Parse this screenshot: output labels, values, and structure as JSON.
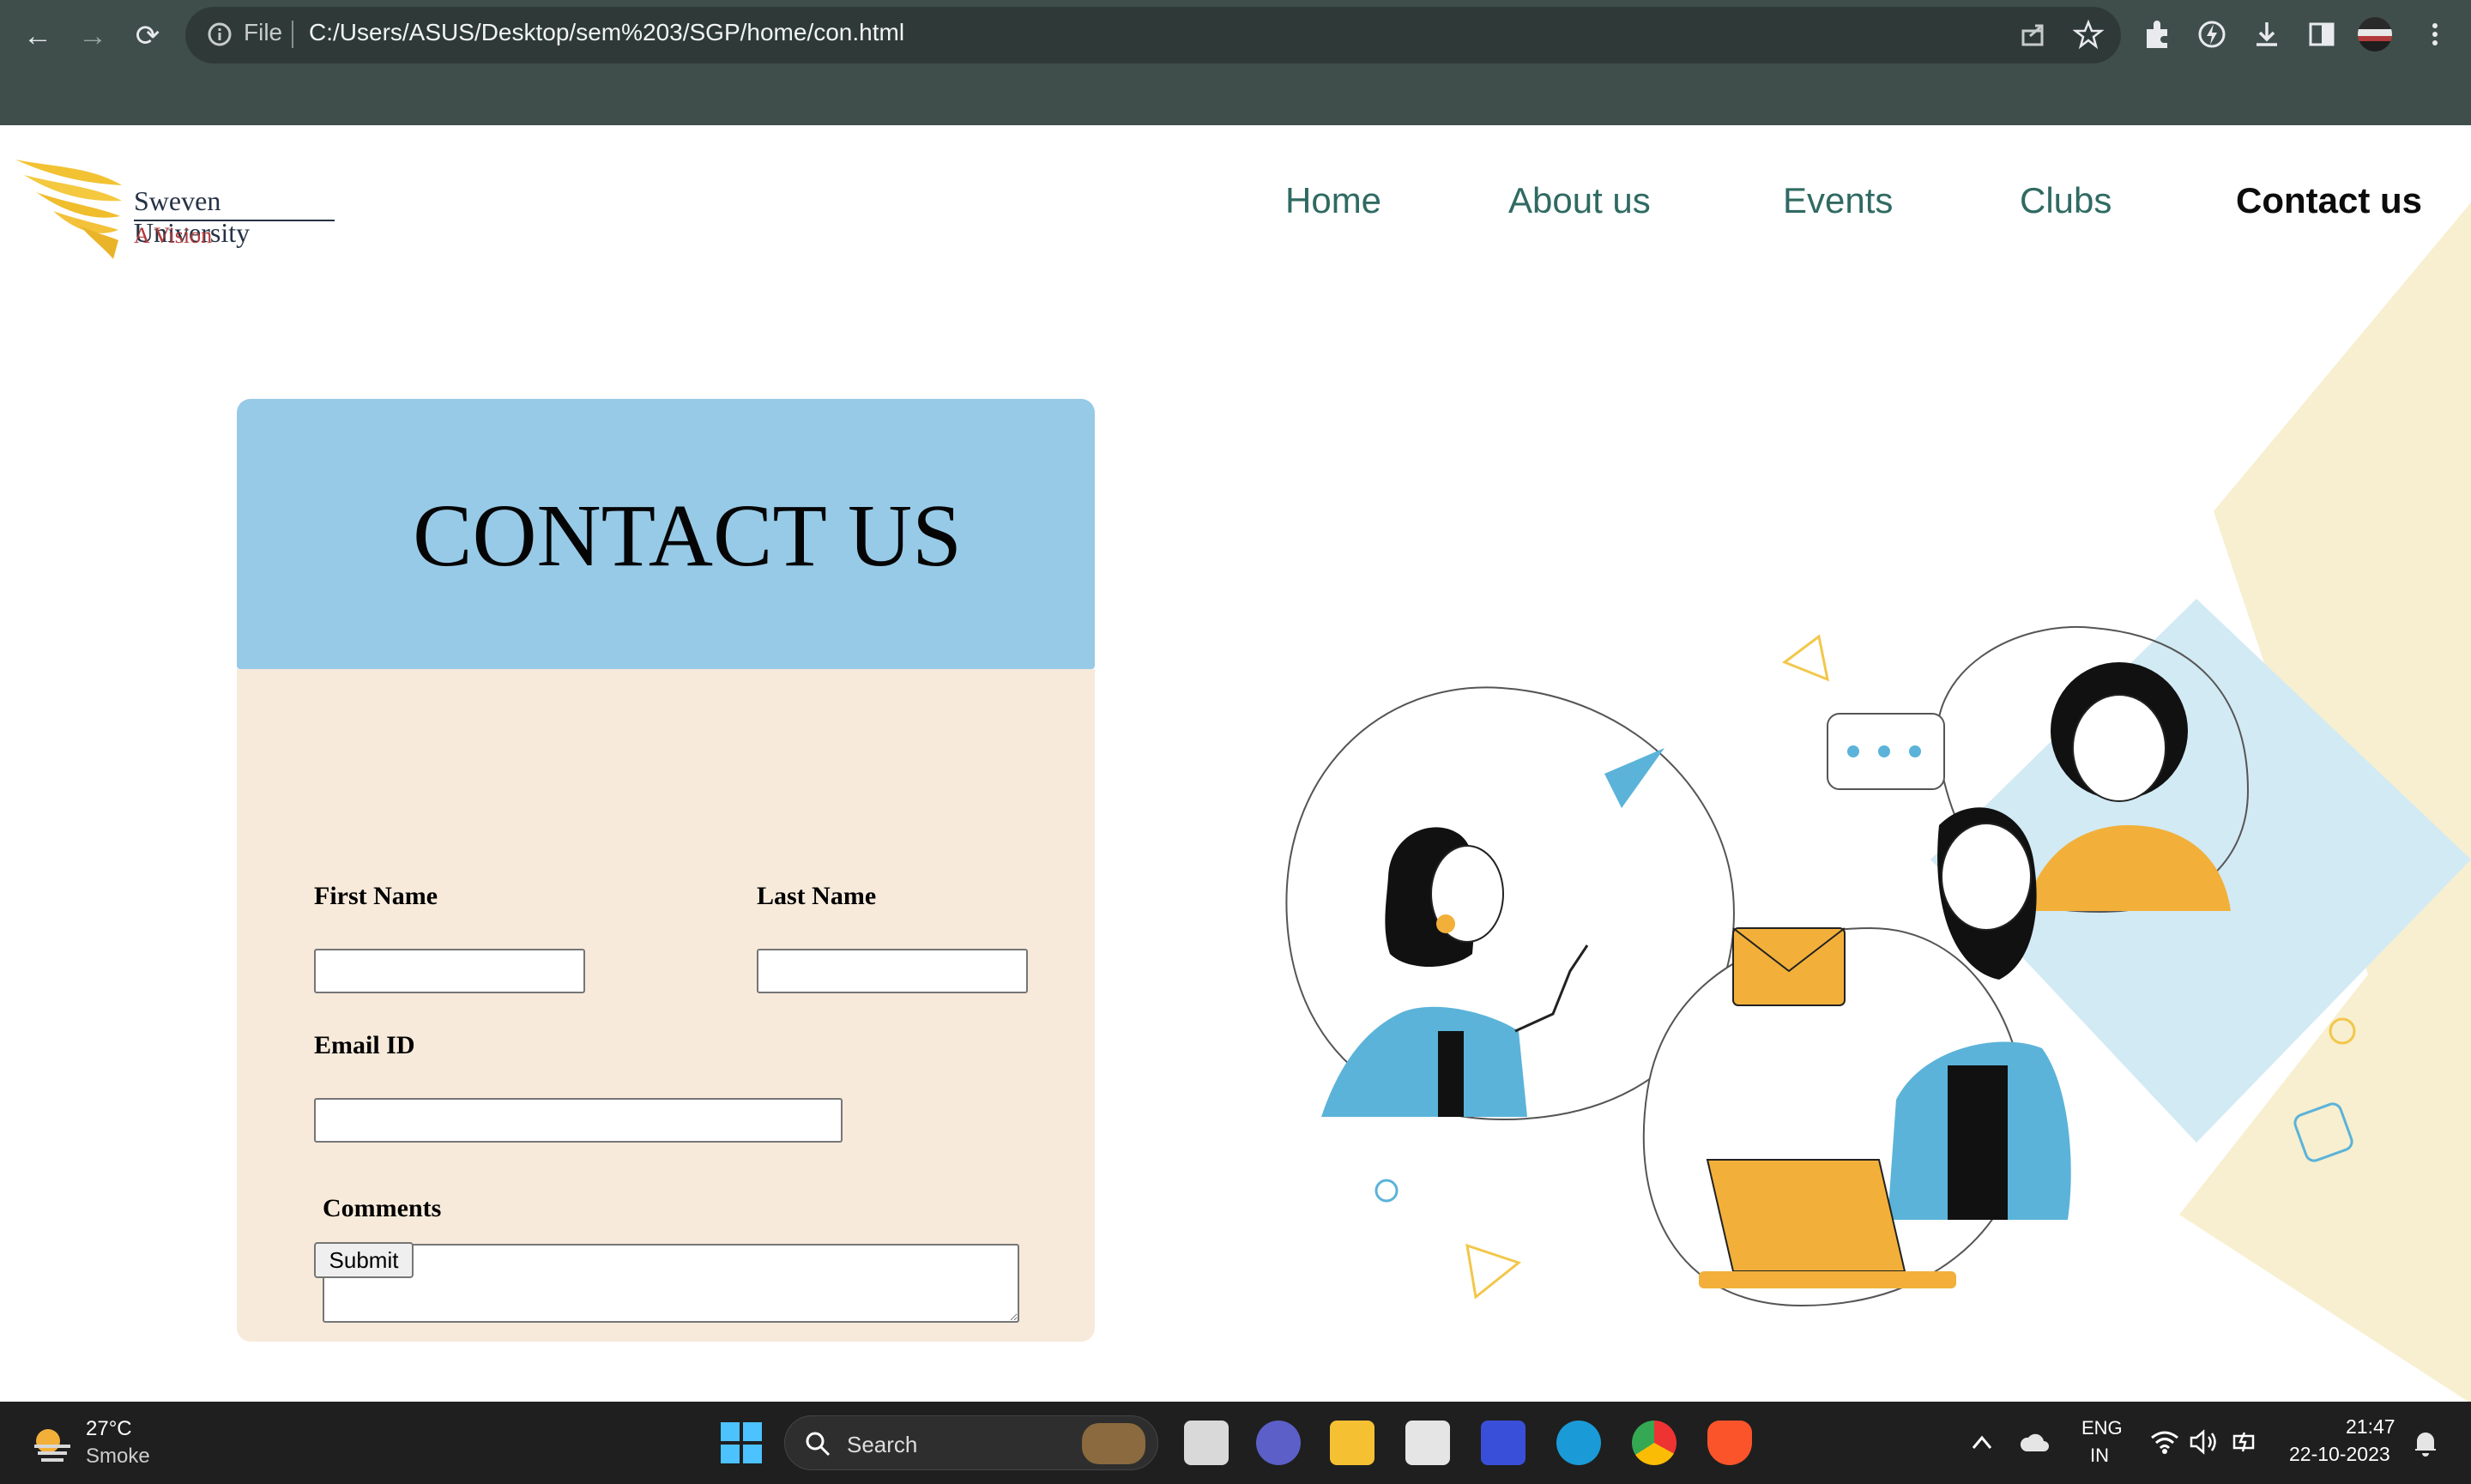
{
  "browser": {
    "back": "←",
    "forward": "→",
    "reload": "⟳",
    "file_label": "File",
    "url": "C:/Users/ASUS/Desktop/sem%203/SGP/home/con.html"
  },
  "site": {
    "logo_name": "Sweven University",
    "logo_tagline": "A Vision",
    "nav": [
      {
        "label": "Home"
      },
      {
        "label": "About us"
      },
      {
        "label": "Events"
      },
      {
        "label": "Clubs"
      },
      {
        "label": "Contact us",
        "active": true
      }
    ]
  },
  "contact": {
    "title": "CONTACT US",
    "first_name_label": "First Name",
    "last_name_label": "Last Name",
    "email_label": "Email ID",
    "comments_label": "Comments",
    "submit_label": "Submit",
    "first_name_value": "",
    "last_name_value": "",
    "email_value": "",
    "comments_value": ""
  },
  "colors": {
    "header_bg": "#97cae7",
    "form_bg": "#f7eadb",
    "nav_text": "#2f6a62",
    "accent_yellow": "#f7efcf"
  },
  "taskbar": {
    "weather_temp": "27°C",
    "weather_desc": "Smoke",
    "search_placeholder": "Search",
    "lang_top": "ENG",
    "lang_bottom": "IN",
    "time": "21:47",
    "date": "22-10-2023"
  }
}
